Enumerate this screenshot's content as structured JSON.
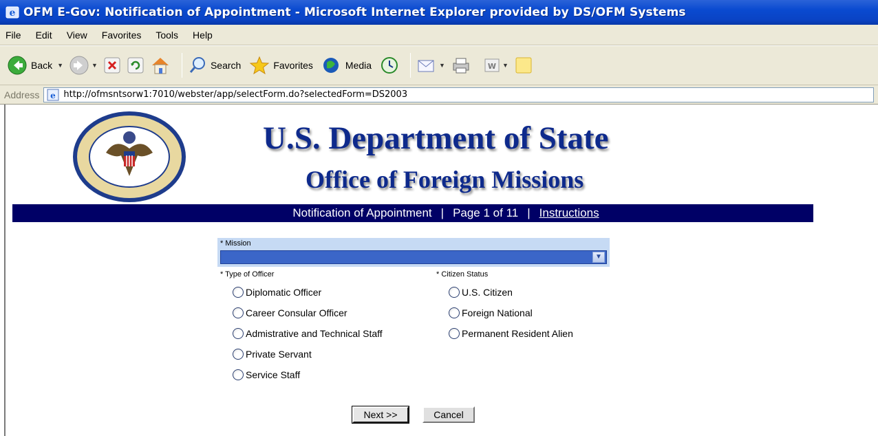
{
  "window": {
    "title": "OFM E-Gov: Notification of Appointment - Microsoft Internet Explorer provided by DS/OFM Systems"
  },
  "menu": [
    "File",
    "Edit",
    "View",
    "Favorites",
    "Tools",
    "Help"
  ],
  "toolbar": {
    "back_label": "Back",
    "search_label": "Search",
    "favorites_label": "Favorites",
    "media_label": "Media"
  },
  "address": {
    "label": "Address",
    "url": "http://ofmsntsorw1:7010/webster/app/selectForm.do?selectedForm=DS2003"
  },
  "header": {
    "title": "U.S. Department of State",
    "subtitle": "Office of Foreign Missions"
  },
  "nav": {
    "form_name": "Notification of Appointment",
    "separator": "|",
    "page_info": "Page 1 of 11",
    "instructions_link": "Instructions"
  },
  "form": {
    "mission_label": "* Mission",
    "mission_value": "",
    "officer_type_label": "* Type of Officer",
    "officer_types": [
      "Diplomatic Officer",
      "Career Consular Officer",
      "Admistrative and Technical Staff",
      "Private Servant",
      "Service Staff"
    ],
    "citizen_status_label": "* Citizen Status",
    "citizen_statuses": [
      "U.S. Citizen",
      "Foreign National",
      "Permanent Resident Alien"
    ]
  },
  "buttons": {
    "next_label": "Next >>",
    "cancel_label": "Cancel"
  },
  "colors": {
    "nav_band": "#000066",
    "heading": "#0e2a8c",
    "mission_panel": "#c6daf4",
    "title_bar": "#0a4ad0"
  }
}
